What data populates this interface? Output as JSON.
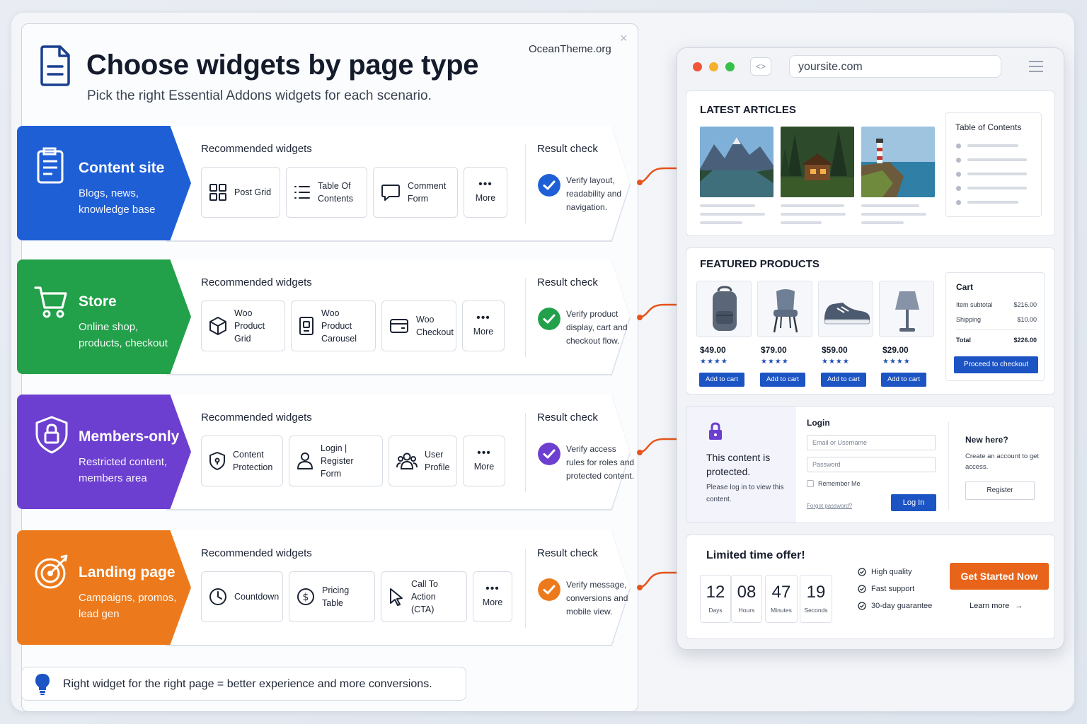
{
  "header": {
    "title": "Choose widgets by page type",
    "subtitle": "Pick the right Essential Addons widgets for each scenario.",
    "brand": "OceanTheme.org",
    "close": "×"
  },
  "rows": [
    {
      "title": "Content site",
      "description": "Blogs, news, knowledge base",
      "color": "#1f5fd6",
      "rec_label": "Recommended widgets",
      "widgets": [
        "Post Grid",
        "Table Of Contents",
        "Comment Form",
        "More"
      ],
      "result_label": "Result check",
      "result_text": "Verify layout, readability and navigation."
    },
    {
      "title": "Store",
      "description": "Online shop, products, checkout",
      "color": "#22a04a",
      "rec_label": "Recommended widgets",
      "widgets": [
        "Woo Product Grid",
        "Woo Product Carousel",
        "Woo Checkout",
        "More"
      ],
      "result_label": "Result check",
      "result_text": "Verify product display, cart and checkout flow."
    },
    {
      "title": "Members-only",
      "description": "Restricted content, members area",
      "color": "#6c3fd0",
      "rec_label": "Recommended widgets",
      "widgets": [
        "Content Protection",
        "Login | Register Form",
        "User Profile",
        "More"
      ],
      "result_label": "Result check",
      "result_text": "Verify access rules for roles and protected content."
    },
    {
      "title": "Landing page",
      "description": "Campaigns, promos, lead gen",
      "color": "#ec7a1c",
      "rec_label": "Recommended widgets",
      "widgets": [
        "Countdown",
        "Pricing Table",
        "Call To Action (CTA)",
        "More"
      ],
      "result_label": "Result check",
      "result_text": "Verify message, conversions and mobile view."
    }
  ],
  "tip": "Right widget for the right page = better experience and more conversions.",
  "browser": {
    "url": "yoursite.com",
    "nav": "<>",
    "articles": {
      "title": "LATEST ARTICLES",
      "toc_title": "Table of Contents"
    },
    "products": {
      "title": "FEATURED PRODUCTS",
      "items": [
        {
          "price": "$49.00",
          "stars": "★★★★",
          "button": "Add to cart"
        },
        {
          "price": "$79.00",
          "stars": "★★★★",
          "button": "Add to cart"
        },
        {
          "price": "$59.00",
          "stars": "★★★★",
          "button": "Add to cart"
        },
        {
          "price": "$29.00",
          "stars": "★★★★",
          "button": "Add to cart"
        }
      ],
      "cart": {
        "title": "Cart",
        "subtotal_label": "Item subtotal",
        "subtotal": "$216.00",
        "shipping_label": "Shipping",
        "shipping": "$10.00",
        "total_label": "Total",
        "total": "$226.00",
        "button": "Proceed to checkout"
      }
    },
    "login": {
      "protected_title": "This content is protected.",
      "protected_text": "Please log in to view this content.",
      "title": "Login",
      "username_placeholder": "Email or Username",
      "password_placeholder": "Password",
      "remember": "Remember Me",
      "forgot": "Forgot password?",
      "button": "Log In",
      "new_title": "New here?",
      "new_text": "Create an account to get access.",
      "register": "Register"
    },
    "offer": {
      "title": "Limited time offer!",
      "countdown": [
        {
          "value": "12",
          "label": "Days"
        },
        {
          "value": "08",
          "label": "Hours"
        },
        {
          "value": "47",
          "label": "Minutes"
        },
        {
          "value": "19",
          "label": "Seconds"
        }
      ],
      "perks": [
        "High quality",
        "Fast support",
        "30-day guarantee"
      ],
      "cta": "Get Started Now",
      "learn_more": "Learn more",
      "learn_arrow": "→"
    }
  },
  "colors": {
    "accent_blue": "#1c54c4",
    "accent_orange": "#e8641b",
    "connector": "#e8541b"
  }
}
